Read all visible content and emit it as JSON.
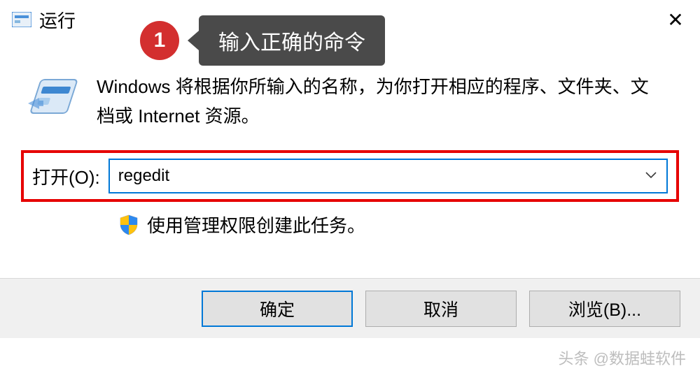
{
  "titlebar": {
    "title": "运行"
  },
  "annotation": {
    "number": "1",
    "text": "输入正确的命令"
  },
  "main": {
    "description": "Windows 将根据你所输入的名称，为你打开相应的程序、文件夹、文档或 Internet 资源。",
    "label": "打开(O):",
    "value": "regedit",
    "admin_note": "使用管理权限创建此任务。"
  },
  "buttons": {
    "ok": "确定",
    "cancel": "取消",
    "browse": "浏览(B)..."
  },
  "watermark": "头条 @数据蛙软件"
}
